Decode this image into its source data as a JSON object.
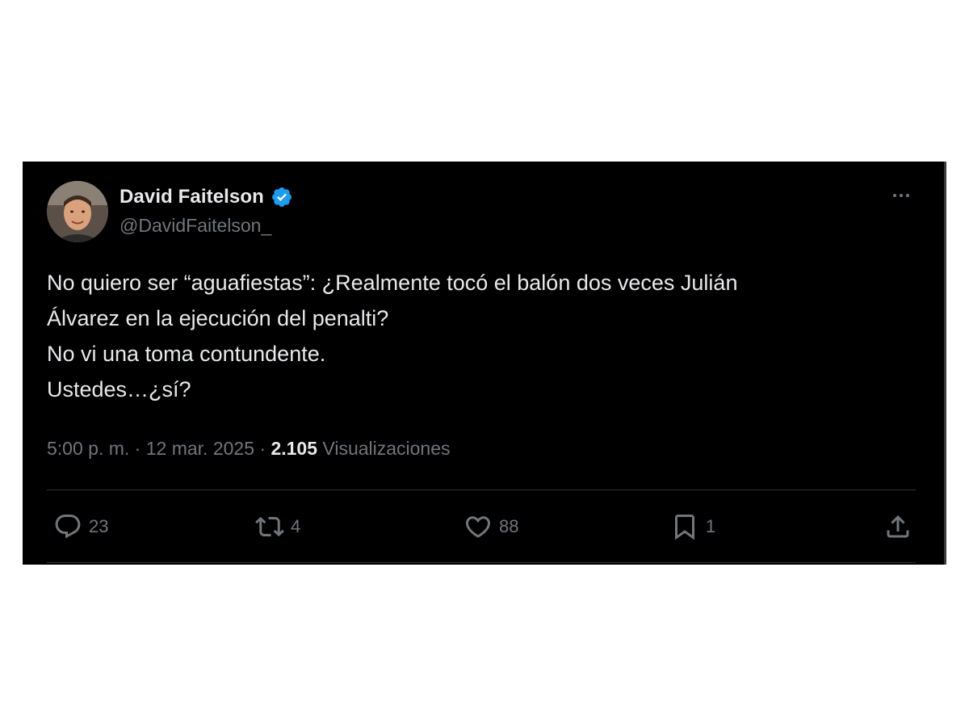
{
  "author": {
    "name": "David Faitelson",
    "handle": "@DavidFaitelson_",
    "verified": true,
    "verified_color": "#1d9bf0"
  },
  "tweet": {
    "lines": [
      "No quiero ser “aguafiestas”: ¿Realmente tocó el balón dos veces Julián",
      "Álvarez en la ejecución del penalti?",
      "No vi una toma contundente.",
      "Ustedes…¿sí?"
    ]
  },
  "meta": {
    "time": "5:00 p. m.",
    "separator": "·",
    "date": "12 mar. 2025",
    "views_count": "2.105",
    "views_label": "Visualizaciones"
  },
  "actions": {
    "replies": "23",
    "retweets": "4",
    "likes": "88",
    "bookmarks": "1"
  },
  "icons": [
    "verified-badge-icon",
    "more-options-icon",
    "reply-icon",
    "retweet-icon",
    "like-icon",
    "bookmark-icon",
    "share-icon"
  ],
  "colors": {
    "background": "#000000",
    "text_primary": "#e7e9ea",
    "text_secondary": "#71767b",
    "divider": "#2f3336"
  }
}
